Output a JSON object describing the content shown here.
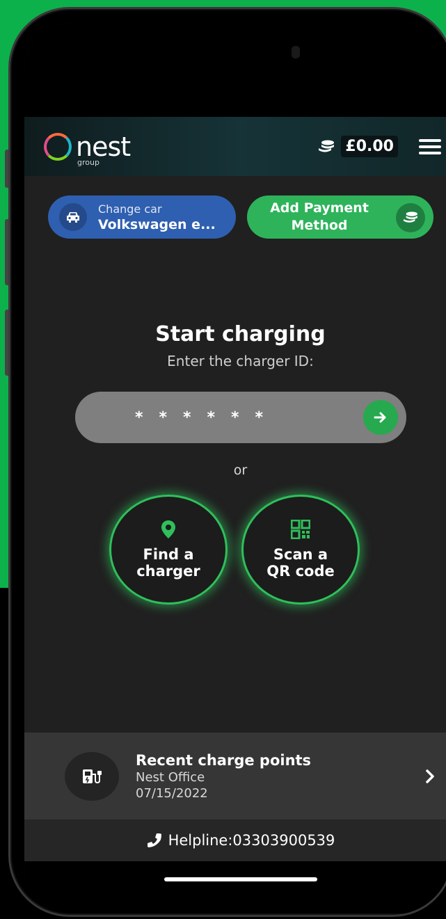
{
  "header": {
    "logo_text": "nest",
    "logo_sub": "group",
    "balance": "£0.00",
    "coins_icon": "coins-icon",
    "menu_icon": "hamburger-menu-icon"
  },
  "car": {
    "label": "Change car",
    "value": "Volkswagen e...",
    "icon": "car-icon"
  },
  "payment": {
    "label_line1": "Add Payment",
    "label_line2": "Method",
    "icon": "coins-icon"
  },
  "charging": {
    "title": "Start charging",
    "subtitle": "Enter the charger ID:",
    "id_value": "******",
    "submit_icon": "arrow-right-icon"
  },
  "or_text": "or",
  "actions": {
    "find_line1": "Find a",
    "find_line2": "charger",
    "find_icon": "map-pin-icon",
    "scan_line1": "Scan a",
    "scan_line2": "QR code",
    "scan_icon": "qr-code-icon"
  },
  "recent": {
    "title": "Recent charge points",
    "location": "Nest Office",
    "date": "07/15/2022",
    "icon": "ev-charger-icon"
  },
  "helpline": {
    "text": "Helpline:03303900539",
    "icon": "phone-icon"
  },
  "colors": {
    "accent_green": "#2eb35a",
    "car_blue": "#2f5fb0",
    "background": "#202020",
    "outer_green": "#0db14b"
  }
}
